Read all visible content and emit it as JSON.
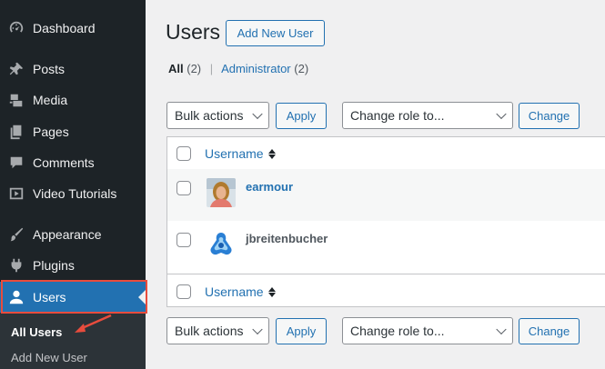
{
  "sidebar": {
    "items": [
      {
        "label": "Dashboard",
        "icon": "dashboard-icon"
      },
      {
        "label": "Posts",
        "icon": "pin-icon"
      },
      {
        "label": "Media",
        "icon": "media-icon"
      },
      {
        "label": "Pages",
        "icon": "pages-icon"
      },
      {
        "label": "Comments",
        "icon": "comment-icon"
      },
      {
        "label": "Video Tutorials",
        "icon": "video-icon"
      },
      {
        "label": "Appearance",
        "icon": "brush-icon"
      },
      {
        "label": "Plugins",
        "icon": "plugin-icon"
      },
      {
        "label": "Users",
        "icon": "user-icon"
      }
    ],
    "submenu": [
      {
        "label": "All Users"
      },
      {
        "label": "Add New User"
      }
    ]
  },
  "header": {
    "title": "Users",
    "add_new_label": "Add New User"
  },
  "filters": {
    "all_label": "All",
    "all_count": "(2)",
    "separator": "|",
    "admin_label": "Administrator",
    "admin_count": "(2)"
  },
  "actions": {
    "bulk_label": "Bulk actions",
    "apply_label": "Apply",
    "role_label": "Change role to...",
    "change_label": "Change"
  },
  "table": {
    "column_username": "Username",
    "rows": [
      {
        "username": "earmour"
      },
      {
        "username": "jbreitenbucher"
      }
    ]
  },
  "colors": {
    "sidebar_bg": "#1d2327",
    "accent": "#2271b1",
    "highlight": "#e84c3d"
  }
}
